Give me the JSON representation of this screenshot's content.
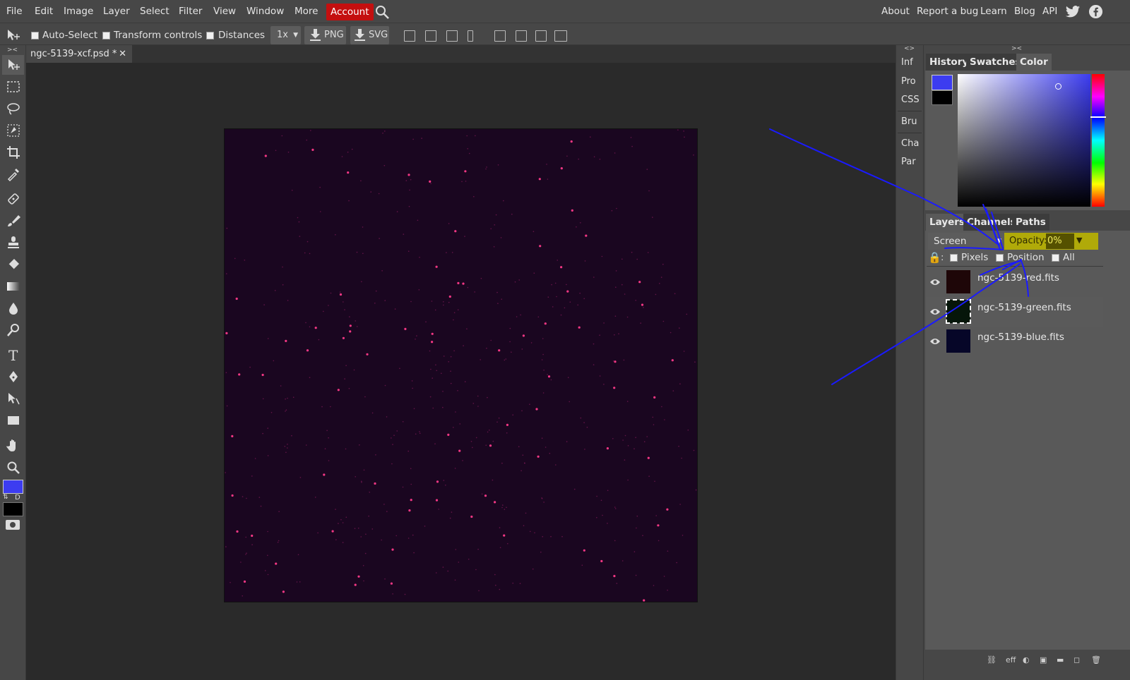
{
  "menubar": {
    "items": [
      "File",
      "Edit",
      "Image",
      "Layer",
      "Select",
      "Filter",
      "View",
      "Window",
      "More"
    ],
    "account": "Account",
    "right_items": [
      "About",
      "Report a bug",
      "Learn",
      "Blog",
      "API"
    ]
  },
  "options": {
    "auto_select": "Auto-Select",
    "transform_controls": "Transform controls",
    "distances": "Distances",
    "zoom": "1x",
    "png": "PNG",
    "svg": "SVG"
  },
  "document": {
    "tab_title": "ngc-5139-xcf.psd *",
    "close": "✕"
  },
  "mid_panel": {
    "items": [
      "Inf",
      "Pro",
      "CSS",
      "Bru",
      "Cha",
      "Par"
    ],
    "collapse": "<>"
  },
  "right_panel": {
    "collapse": ">< ",
    "color_tabs": [
      "History",
      "Swatches",
      "Color"
    ],
    "active_color_tab": "Color",
    "layer_tabs": [
      "Layers",
      "Channels",
      "Paths"
    ],
    "active_layer_tab": "Layers",
    "blend_mode": "Screen",
    "opacity_label": "Opacity:",
    "opacity_value": "0%",
    "lock_label": ":",
    "lock_pixels": "Pixels",
    "lock_position": "Position",
    "lock_all": "All",
    "layers": [
      {
        "name": "ngc-5139-red.fits",
        "thumb_color": "#1e0608"
      },
      {
        "name": "ngc-5139-green.fits",
        "thumb_color": "#06160a"
      },
      {
        "name": "ngc-5139-blue.fits",
        "thumb_color": "#060628"
      }
    ],
    "selected_layer": "ngc-5139-green.fits",
    "footer_eff": "eff"
  },
  "colors": {
    "foreground": "#3c3cf0",
    "background": "#000000",
    "account_bg": "#c40f0f",
    "annotation_stroke": "#1a1aff",
    "highlight": "#b9b300"
  },
  "toolbar_swap_label": "D"
}
